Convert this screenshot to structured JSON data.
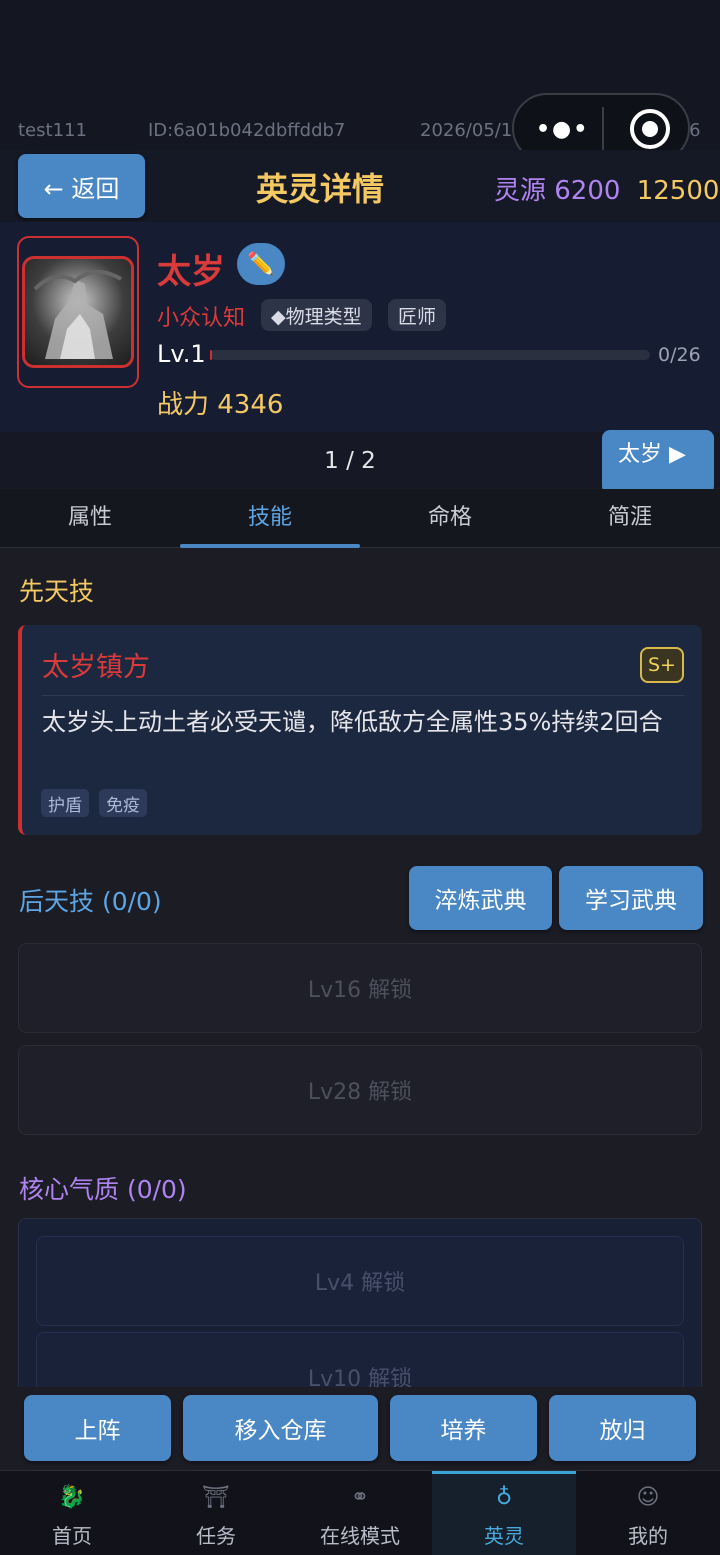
{
  "status": {
    "user": "test111",
    "id": "ID:6a01b042dbffddb7",
    "date": "2026/05/11 18:32",
    "version": "4.6"
  },
  "header": {
    "back_label": "← 返回",
    "title": "英灵详情",
    "resource_label": "灵源 6200",
    "gold": "12500"
  },
  "hero": {
    "name": "太岁",
    "edit_icon": "pencil-icon",
    "rarity": "小众认知",
    "tags": [
      "◆物理类型",
      "匠师"
    ],
    "level": "Lv.1",
    "xp_text": "0/26",
    "xp_fraction": 0.0,
    "power": "战力 4346"
  },
  "pager": {
    "text": "1 / 2",
    "next_label": "太岁 ▶"
  },
  "tabs": [
    "属性",
    "技能",
    "命格",
    "简涯"
  ],
  "active_tab": "技能",
  "innate": {
    "section_title": "先天技",
    "skill_name": "太岁镇方",
    "grade": "S+",
    "description": "太岁头上动土者必受天谴，降低敌方全属性35%持续2回合",
    "tags": [
      "护盾",
      "免疫"
    ]
  },
  "acquired": {
    "section_title": "后天技 (0/0)",
    "refine_label": "淬炼武典",
    "learn_label": "学习武典",
    "slots": [
      "Lv16 解锁",
      "Lv28 解锁"
    ]
  },
  "core": {
    "section_title": "核心气质 (0/0)",
    "slots": [
      "Lv4 解锁",
      "Lv10 解锁"
    ]
  },
  "actions": [
    "上阵",
    "移入仓库",
    "培养",
    "放归"
  ],
  "nav": [
    {
      "label": "首页",
      "icon": "dragon-icon"
    },
    {
      "label": "任务",
      "icon": "scroll-icon"
    },
    {
      "label": "在线模式",
      "icon": "rings-icon"
    },
    {
      "label": "英灵",
      "icon": "spirit-icon"
    },
    {
      "label": "我的",
      "icon": "profile-icon"
    }
  ],
  "colors": {
    "accent": "#4a87c5",
    "gold": "#f4c862",
    "red": "#d93a3a",
    "purple": "#b084f0",
    "blue_title": "#5ea5e3"
  }
}
